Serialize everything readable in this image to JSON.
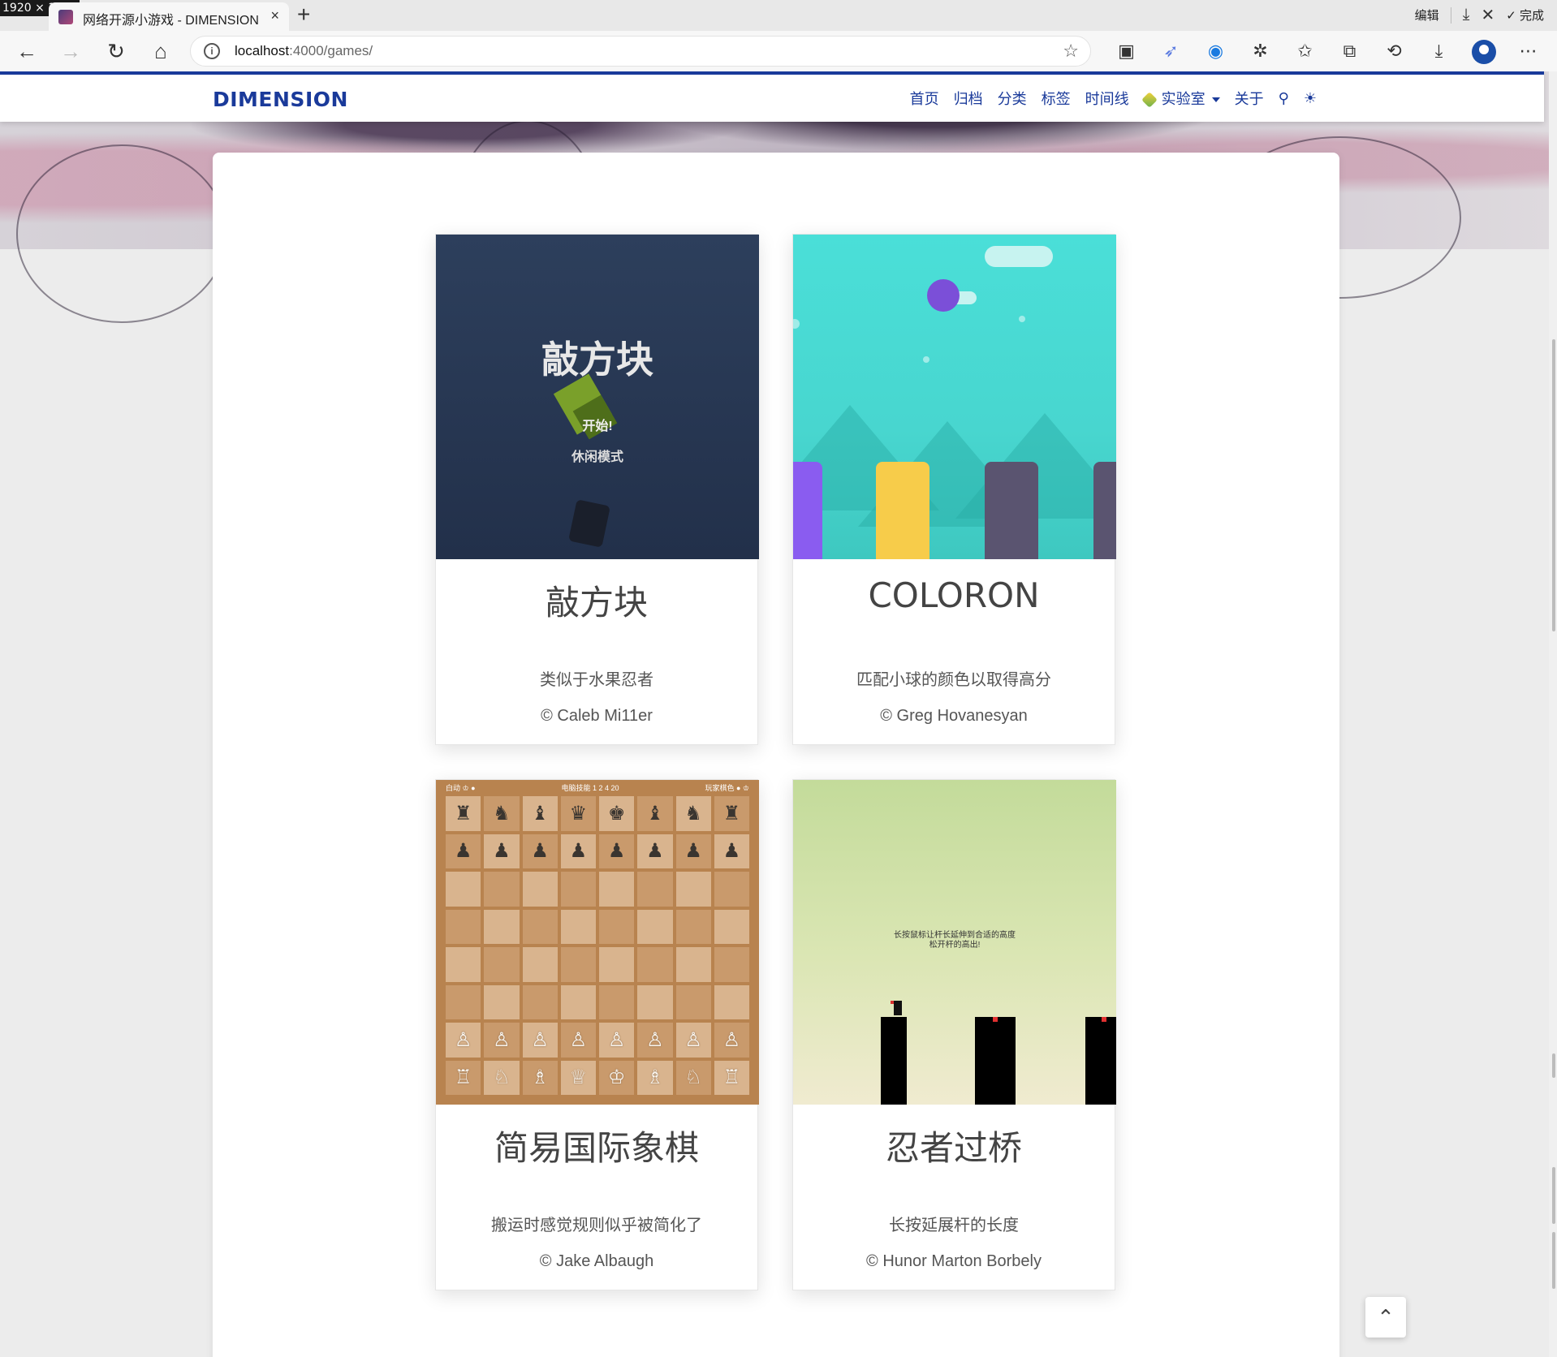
{
  "screen_badge": "1920 × 1080",
  "tab": {
    "title": "网络开源小游戏 - DIMENSION",
    "close": "×",
    "new": "+"
  },
  "toolbar_right": {
    "edit": "编辑",
    "done": "完成"
  },
  "address": {
    "host": "localhost",
    "path": ":4000/games/"
  },
  "site": {
    "brand": "DIMENSION",
    "menu": [
      "首页",
      "归档",
      "分类",
      "标签",
      "时间线",
      "实验室",
      "关于"
    ]
  },
  "games": [
    {
      "title": "敲方块",
      "desc": "类似于水果忍者",
      "author": "© Caleb Mi11er",
      "thumb": {
        "title": "敲方块",
        "start": "开始!",
        "mode": "休闲模式"
      }
    },
    {
      "title": "COLORON",
      "desc": "匹配小球的颜色以取得高分",
      "author": "© Greg Hovanesyan"
    },
    {
      "title": "简易国际象棋",
      "desc": "搬运时感觉规则似乎被简化了",
      "author": "© Jake Albaugh",
      "thumb": {
        "left": "白动 ♔ ●",
        "center": "电脑技能 1 2 4 20",
        "right": "玩家棋色 ● ♔"
      }
    },
    {
      "title": "忍者过桥",
      "desc": "长按延展杆的长度",
      "author": "© Hunor Marton Borbely",
      "thumb": {
        "hint1": "长按鼠标让杆长延伸到合适的高度",
        "hint2": "松开杆的高出!"
      }
    }
  ],
  "colors": {
    "brand": "#1a3a9a",
    "card_bg": "#ffffff",
    "page_bg": "#ececec"
  }
}
